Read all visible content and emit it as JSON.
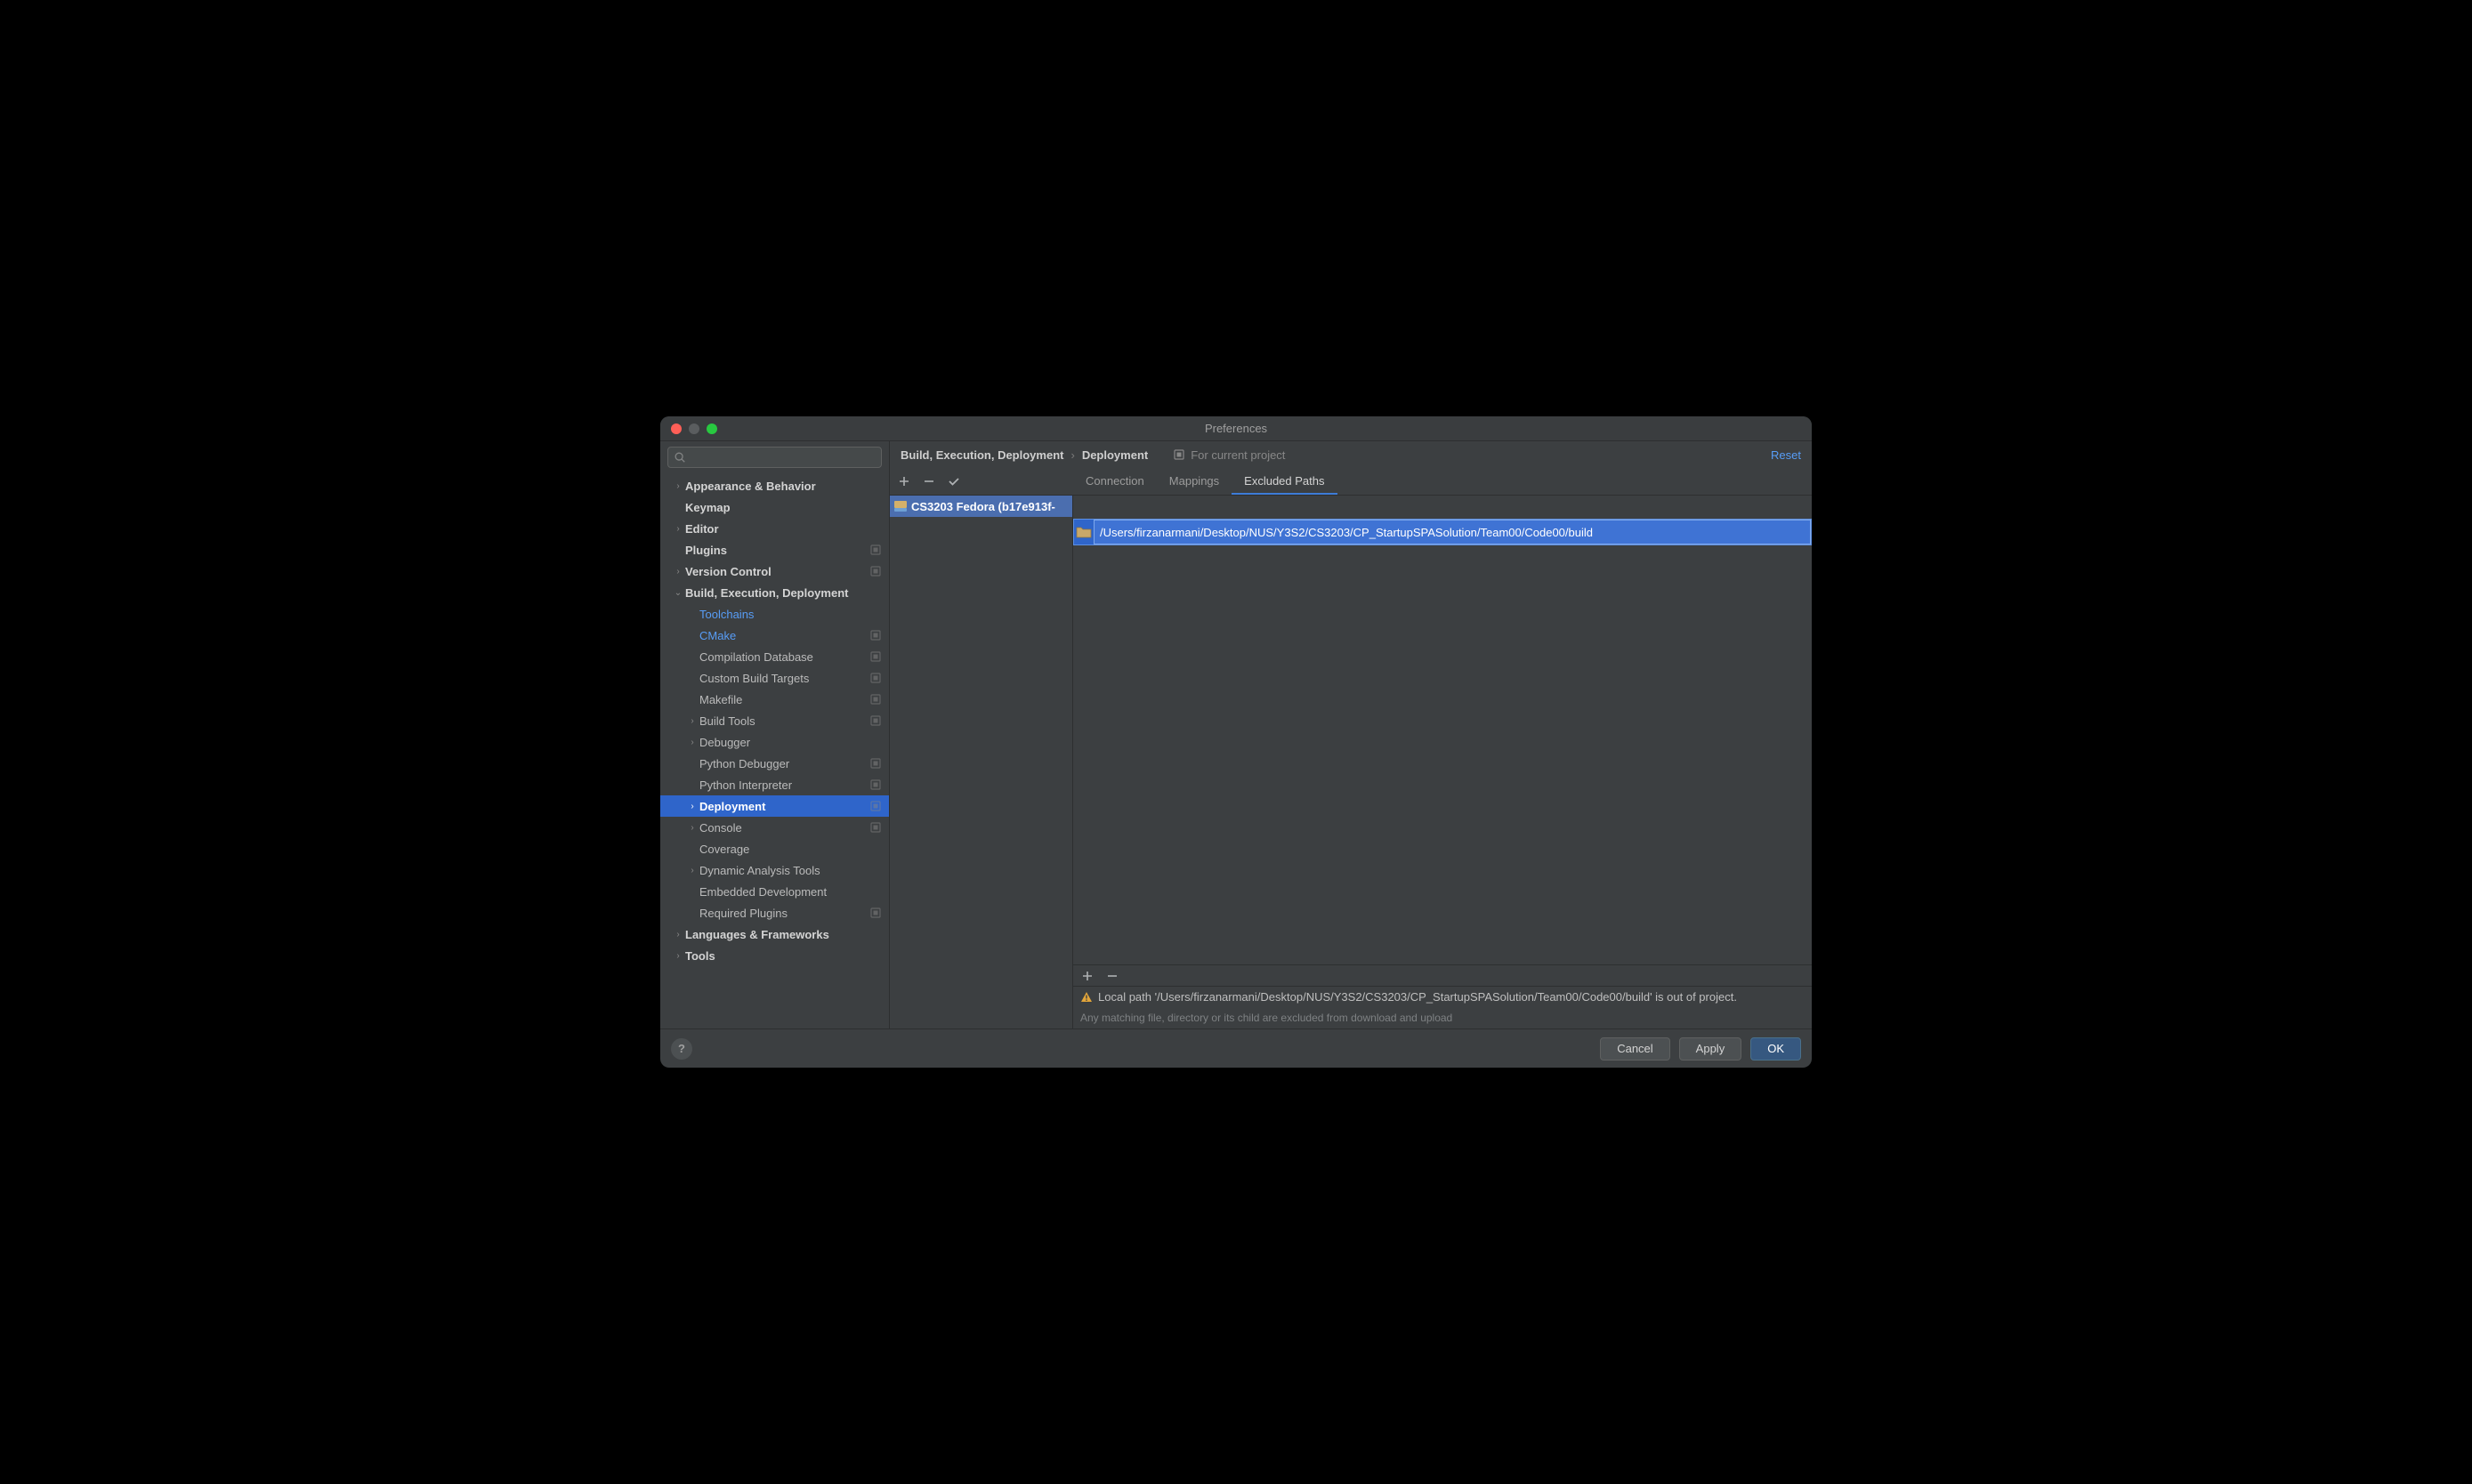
{
  "window": {
    "title": "Preferences"
  },
  "header": {
    "breadcrumb": [
      "Build, Execution, Deployment",
      "Deployment"
    ],
    "for_project": "For current project",
    "reset": "Reset"
  },
  "sidebar": {
    "items": [
      {
        "label": "Appearance & Behavior",
        "depth": 0,
        "chev": "right",
        "bold": true
      },
      {
        "label": "Keymap",
        "depth": 0,
        "bold": true,
        "indent_no_chev": true
      },
      {
        "label": "Editor",
        "depth": 0,
        "chev": "right",
        "bold": true
      },
      {
        "label": "Plugins",
        "depth": 0,
        "bold": true,
        "badge": true,
        "indent_no_chev": true
      },
      {
        "label": "Version Control",
        "depth": 0,
        "chev": "right",
        "bold": true,
        "badge": true
      },
      {
        "label": "Build, Execution, Deployment",
        "depth": 0,
        "chev": "down",
        "bold": true
      },
      {
        "label": "Toolchains",
        "depth": 1,
        "link": true,
        "indent_no_chev": true
      },
      {
        "label": "CMake",
        "depth": 1,
        "link": true,
        "badge": true,
        "indent_no_chev": true
      },
      {
        "label": "Compilation Database",
        "depth": 1,
        "badge": true,
        "indent_no_chev": true
      },
      {
        "label": "Custom Build Targets",
        "depth": 1,
        "badge": true,
        "indent_no_chev": true
      },
      {
        "label": "Makefile",
        "depth": 1,
        "badge": true,
        "indent_no_chev": true
      },
      {
        "label": "Build Tools",
        "depth": 1,
        "chev": "right",
        "badge": true
      },
      {
        "label": "Debugger",
        "depth": 1,
        "chev": "right"
      },
      {
        "label": "Python Debugger",
        "depth": 1,
        "badge": true,
        "indent_no_chev": true
      },
      {
        "label": "Python Interpreter",
        "depth": 1,
        "badge": true,
        "indent_no_chev": true
      },
      {
        "label": "Deployment",
        "depth": 1,
        "chev": "right",
        "bold": true,
        "badge": true,
        "selected": true
      },
      {
        "label": "Console",
        "depth": 1,
        "chev": "right",
        "badge": true
      },
      {
        "label": "Coverage",
        "depth": 1,
        "indent_no_chev": true
      },
      {
        "label": "Dynamic Analysis Tools",
        "depth": 1,
        "chev": "right"
      },
      {
        "label": "Embedded Development",
        "depth": 1,
        "indent_no_chev": true
      },
      {
        "label": "Required Plugins",
        "depth": 1,
        "badge": true,
        "indent_no_chev": true
      },
      {
        "label": "Languages & Frameworks",
        "depth": 0,
        "chev": "right",
        "bold": true
      },
      {
        "label": "Tools",
        "depth": 0,
        "chev": "right",
        "bold": true
      }
    ]
  },
  "tabs": {
    "items": [
      "Connection",
      "Mappings",
      "Excluded Paths"
    ],
    "active": 2
  },
  "servers": {
    "items": [
      {
        "label": "CS3203 Fedora (b17e913f-"
      }
    ]
  },
  "excluded": {
    "path": "/Users/firzanarmani/Desktop/NUS/Y3S2/CS3203/CP_StartupSPASolution/Team00/Code00/build",
    "warning": "Local path '/Users/firzanarmani/Desktop/NUS/Y3S2/CS3203/CP_StartupSPASolution/Team00/Code00/build' is out of project.",
    "hint": "Any matching file, directory or its child are excluded from download and upload"
  },
  "footer": {
    "cancel": "Cancel",
    "apply": "Apply",
    "ok": "OK"
  }
}
